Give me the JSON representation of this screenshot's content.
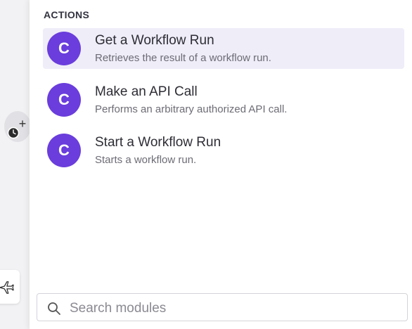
{
  "colors": {
    "accent": "#6a3ddc",
    "active_row": "#efedf8",
    "panel_bg": "#ffffff"
  },
  "canvas": {
    "add_icon": "plus-icon",
    "schedule_icon": "clock-icon",
    "tool_icon": "airplane-icon"
  },
  "panel": {
    "section_title": "ACTIONS",
    "items": [
      {
        "icon_letter": "C",
        "title": "Get a Workflow Run",
        "description": "Retrieves the result of a workflow run.",
        "active": true
      },
      {
        "icon_letter": "C",
        "title": "Make an API Call",
        "description": "Performs an arbitrary authorized API call.",
        "active": false
      },
      {
        "icon_letter": "C",
        "title": "Start a Workflow Run",
        "description": "Starts a workflow run.",
        "active": false
      }
    ]
  },
  "search": {
    "placeholder": "Search modules",
    "value": "",
    "icon": "search-icon"
  }
}
